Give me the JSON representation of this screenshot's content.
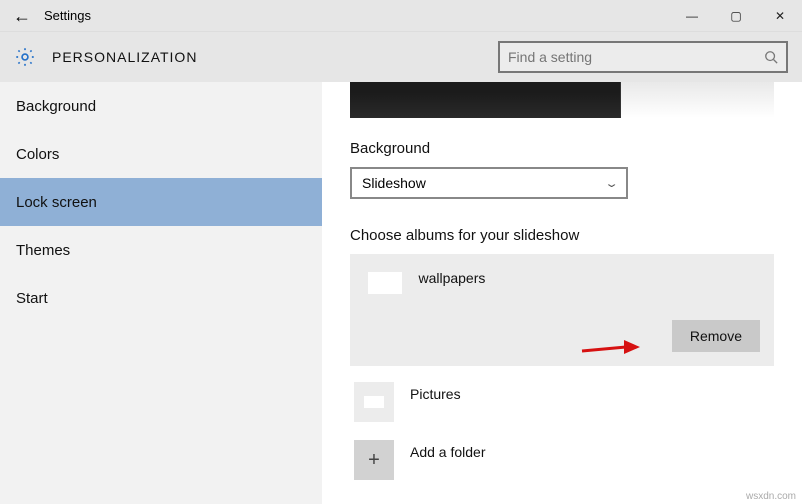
{
  "window": {
    "title": "Settings"
  },
  "header": {
    "category": "PERSONALIZATION",
    "search_placeholder": "Find a setting"
  },
  "sidebar": {
    "items": [
      {
        "label": "Background",
        "selected": false
      },
      {
        "label": "Colors",
        "selected": false
      },
      {
        "label": "Lock screen",
        "selected": true
      },
      {
        "label": "Themes",
        "selected": false
      },
      {
        "label": "Start",
        "selected": false
      }
    ]
  },
  "content": {
    "background_label": "Background",
    "background_value": "Slideshow",
    "choose_label": "Choose albums for your slideshow",
    "albums": [
      {
        "name": "wallpapers",
        "removable": true
      },
      {
        "name": "Pictures",
        "removable": false
      }
    ],
    "remove_label": "Remove",
    "add_label": "Add a folder"
  },
  "watermark": "wsxdn.com"
}
